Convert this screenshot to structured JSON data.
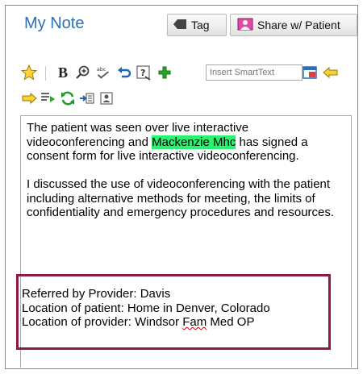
{
  "header": {
    "title": "My Note",
    "tag_label_prefix": "Ta",
    "tag_label_accel": "g",
    "share_label": "Share w/ Patient"
  },
  "toolbar": {
    "bold_label": "B",
    "smarttext_placeholder": "Insert SmartText"
  },
  "note": {
    "para1_a": "The patient was seen over live interactive videoconferencing and ",
    "para1_name": "Mackenzie Mhc",
    "para1_b": " has signed a consent form for live interactive videoconferencing.",
    "para2": "I discussed the use of videoconferencing with the patient including alternative methods for meeting, the limits of confidentiality and emergency procedures and resources.",
    "line_referred": "Referred by Provider: Davis",
    "line_location_patient": "Location of patient:  Home in Denver, Colorado",
    "line_location_provider_a": "Location of provider:  Windsor ",
    "line_location_provider_fam": "Fam",
    "line_location_provider_b": " Med OP"
  },
  "colors": {
    "title": "#2e6fb0",
    "highlight": "#2cf36f",
    "box_border": "#8e1a3c"
  }
}
